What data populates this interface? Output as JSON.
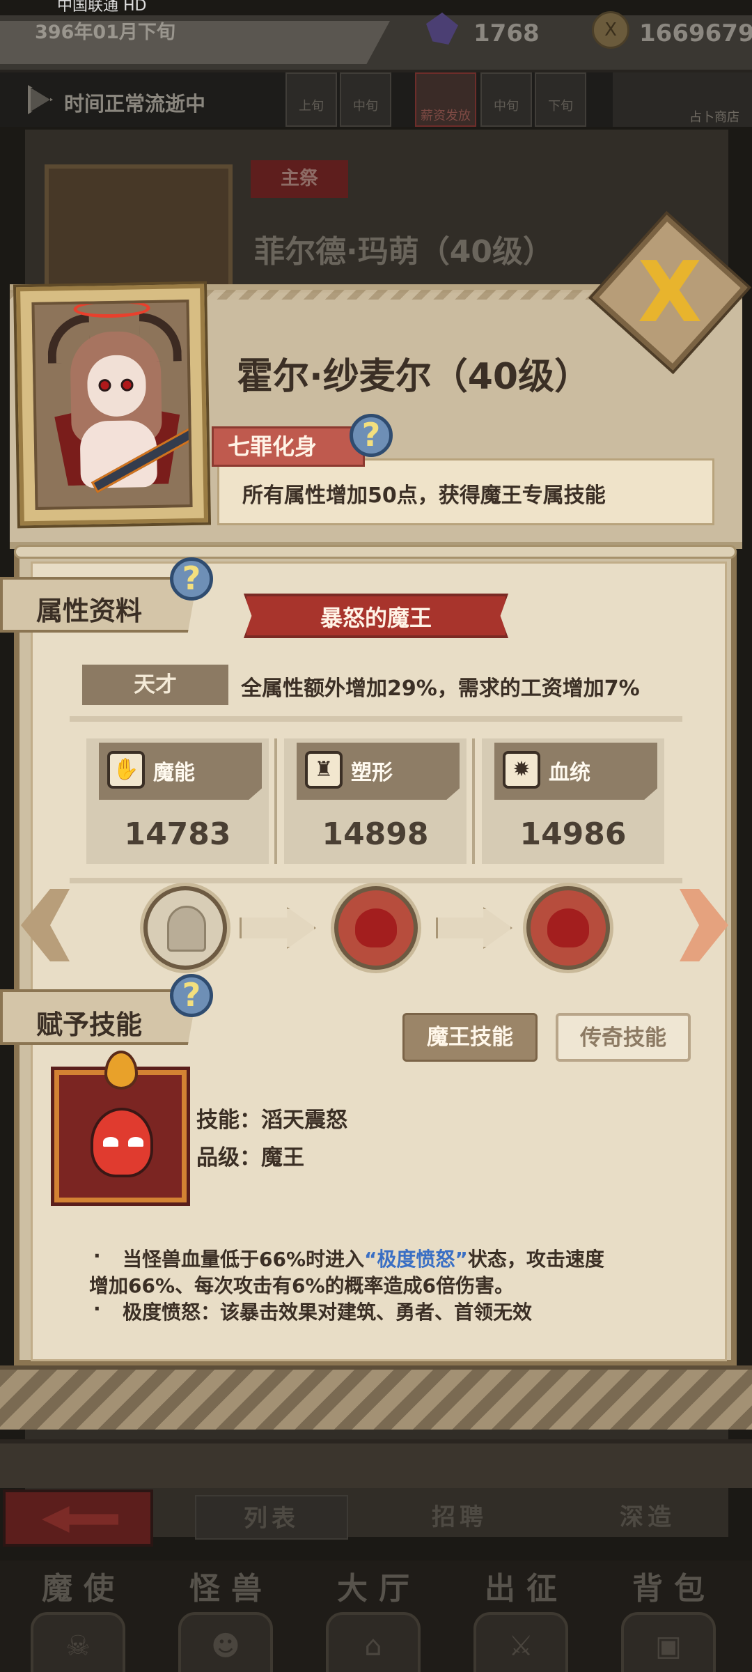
{
  "status": {
    "carrier": "中国联通 HD"
  },
  "topbar": {
    "date": "396年01月下旬",
    "crystals": "1768",
    "coins": "1669679",
    "coin_icon": "X"
  },
  "timebar": {
    "status_text": "时间正常流逝中",
    "periods": [
      "上旬",
      "中旬",
      "中旬",
      "下旬"
    ],
    "salary_button": "薪资发放",
    "divination_button": "占卜商店"
  },
  "background": {
    "role_tag": "主祭",
    "hero_name": "菲尔德·玛萌（40级）"
  },
  "modal": {
    "hero_name": "霍尔·纱麦尔（40级）",
    "title_badge": "七罪化身",
    "title_desc": "所有属性增加50点，获得魔王专属技能",
    "help_mark": "?",
    "close_mark": "X",
    "attributes": {
      "section_label": "属性资料",
      "ribbon": "暴怒的魔王",
      "trait_tag": "天才",
      "trait_desc": "全属性额外增加29%，需求的工资增加7%",
      "stats": [
        {
          "label": "魔能",
          "value": "14783",
          "icon": "claw-icon"
        },
        {
          "label": "塑形",
          "value": "14898",
          "icon": "torso-icon"
        },
        {
          "label": "血统",
          "value": "14986",
          "icon": "gear-icon"
        }
      ]
    },
    "skills": {
      "section_label": "赋予技能",
      "tabs": {
        "demon_king": "魔王技能",
        "legendary": "传奇技能"
      },
      "skill_name_line": "技能：滔天震怒",
      "skill_grade_line": "品级：魔王",
      "desc": {
        "bullet": "·",
        "line1_a": "当怪兽血量低于66%时进入",
        "line1_highlight": "“极度愤怒”",
        "line1_b": "状态，攻击速度",
        "line2": "增加66%、每次攻击有6%的概率造成6倍伤害。",
        "line3": "极度愤怒：该暴击效果对建筑、勇者、首领无效"
      }
    }
  },
  "subtabs": {
    "list": "列表",
    "recruit": "招聘",
    "deepen": "深造"
  },
  "nav": [
    {
      "label": "魔使"
    },
    {
      "label": "怪兽"
    },
    {
      "label": "大厅"
    },
    {
      "label": "出征"
    },
    {
      "label": "背包"
    }
  ],
  "colors": {
    "accent_red": "#a8342c",
    "highlight_blue": "#3a6fc4",
    "parchment": "#e8ddc6"
  }
}
